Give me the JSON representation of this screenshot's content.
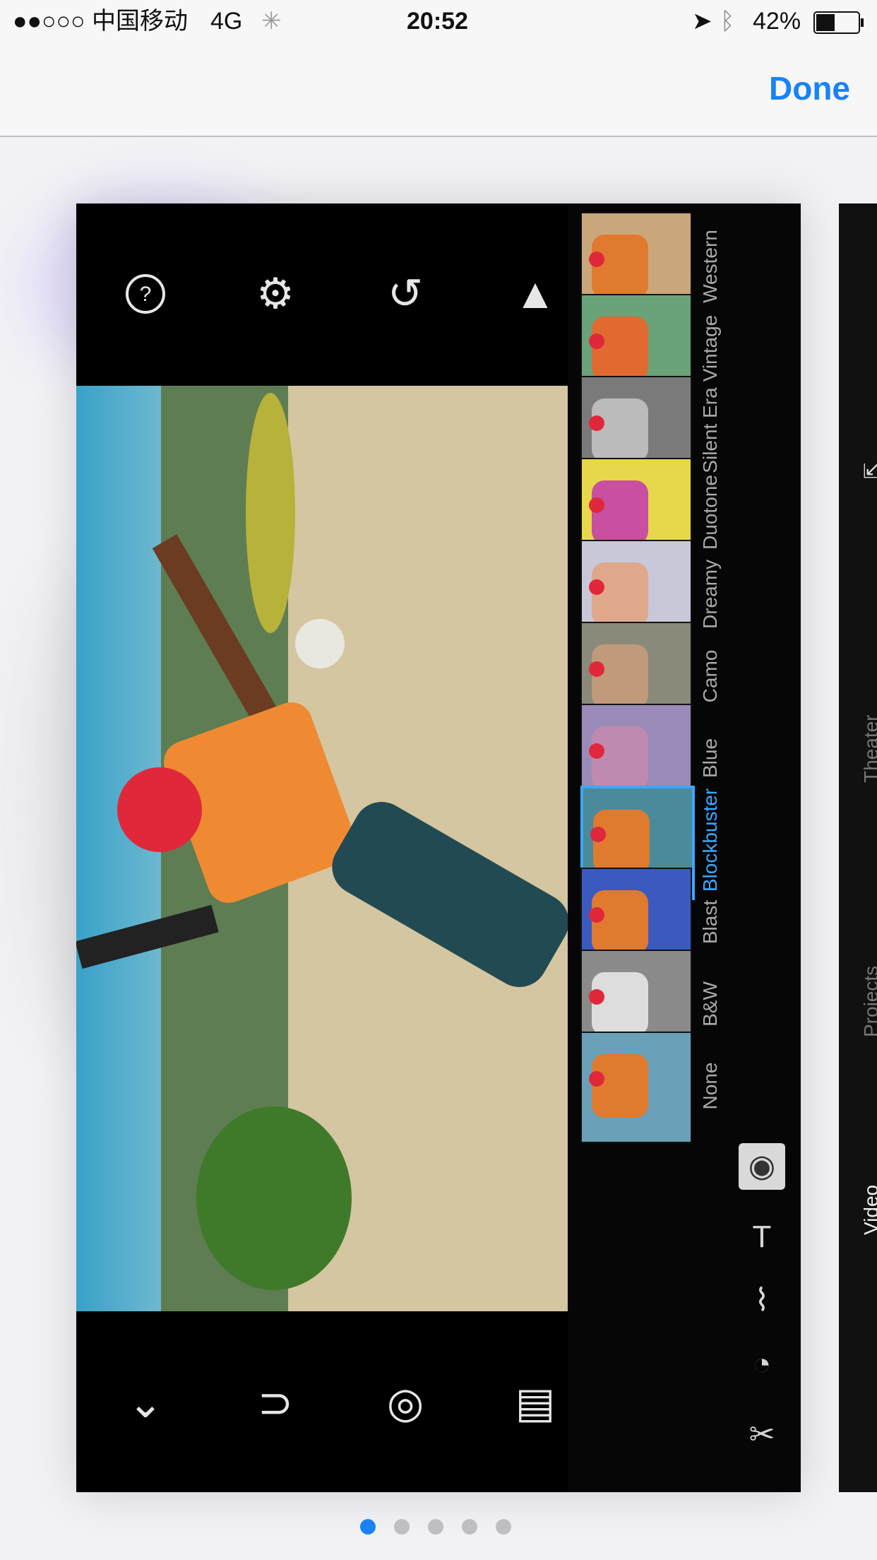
{
  "status_bar": {
    "signal": "●●○○○",
    "carrier": "中国移动",
    "network": "4G",
    "time": "20:52",
    "battery_percent": "42%",
    "battery_level": 0.42
  },
  "nav": {
    "done_label": "Done"
  },
  "colors": {
    "accent": "#1a82f5",
    "filter_selected": "#3aa8ff"
  },
  "screenshot": {
    "filters": [
      {
        "label": "Western",
        "icon": "western-thumb"
      },
      {
        "label": "Vintage",
        "icon": "vintage-thumb"
      },
      {
        "label": "Silent Era",
        "icon": "silent-era-thumb"
      },
      {
        "label": "Duotone",
        "icon": "duotone-thumb"
      },
      {
        "label": "Dreamy",
        "icon": "dreamy-thumb"
      },
      {
        "label": "Camo",
        "icon": "camo-thumb"
      },
      {
        "label": "Blue",
        "icon": "blue-thumb"
      },
      {
        "label": "Blockbuster",
        "icon": "blockbuster-thumb",
        "selected": true
      },
      {
        "label": "Blast",
        "icon": "blast-thumb"
      },
      {
        "label": "B&W",
        "icon": "bw-thumb"
      },
      {
        "label": "None",
        "icon": "none-thumb"
      }
    ],
    "right_card_labels": [
      "Theater",
      "Projects",
      "Video"
    ]
  },
  "pagination": {
    "pages": 5,
    "current": 1
  }
}
